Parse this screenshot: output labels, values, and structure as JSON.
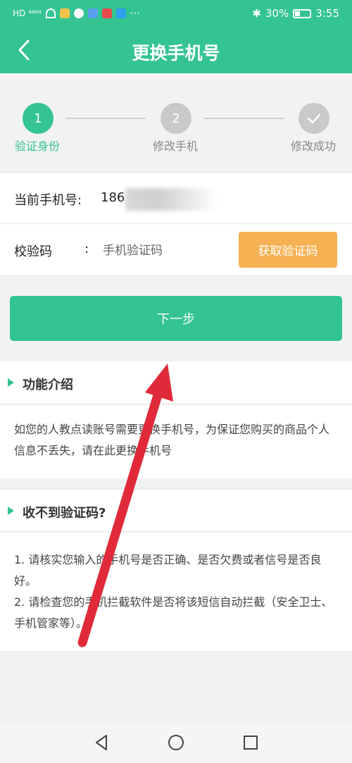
{
  "status_bar": {
    "left_text": "HD ⁴⁶ᴵᴵᴵᴵ",
    "overflow": "···",
    "battery_pct": "30%",
    "time": "3:55"
  },
  "app_bar": {
    "title": "更换手机号",
    "back_icon": "chevron-left-icon"
  },
  "steps": [
    {
      "number": "1",
      "label": "验证身份",
      "state": "active"
    },
    {
      "number": "2",
      "label": "修改手机",
      "state": "pending"
    },
    {
      "number": "",
      "label": "修改成功",
      "state": "pending-check"
    }
  ],
  "colors": {
    "accent": "#34c491",
    "orange": "#f6b153",
    "pending": "#c9c9c9",
    "arrow": "#e02a3a"
  },
  "form": {
    "phone_label": "当前手机号:",
    "phone_value": "186",
    "code_label": "校验码",
    "code_colon": ":",
    "code_placeholder": "手机验证码",
    "get_code_button": "获取验证码"
  },
  "next_button": "下一步",
  "section1": {
    "title": "功能介绍",
    "body": "如您的人教点读账号需要更换手机号，为保证您购买的商品个人信息不丢失，请在此更换手机号"
  },
  "section2": {
    "title": "收不到验证码?",
    "line1": "1. 请核实您输入的手机号是否正确、是否欠费或者信号是否良好。",
    "line2": "2. 请检查您的手机拦截软件是否将该短信自动拦截（安全卫士、手机管家等）。"
  }
}
